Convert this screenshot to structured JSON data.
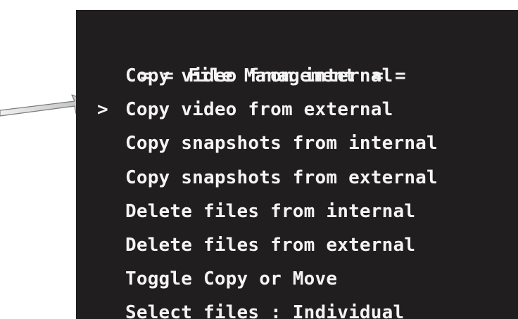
{
  "menu": {
    "title": "File Management",
    "title_decor": "= =",
    "cursor": ">",
    "selected_index": 1,
    "items": [
      {
        "label": "Copy video from internal"
      },
      {
        "label": "Copy video from external"
      },
      {
        "label": "Copy snapshots from internal"
      },
      {
        "label": "Copy snapshots from external"
      },
      {
        "label": "Delete files from internal"
      },
      {
        "label": "Delete files from external"
      },
      {
        "label": "Toggle Copy or Move"
      },
      {
        "label": "Select files : Individual"
      }
    ]
  },
  "colors": {
    "screen_background": "#211e1f",
    "text": "#f4f4f4",
    "page_background": "#ffffff",
    "arrow": "#e8e8e8"
  },
  "annotation": {
    "icon": "pointer-arrow-icon"
  }
}
